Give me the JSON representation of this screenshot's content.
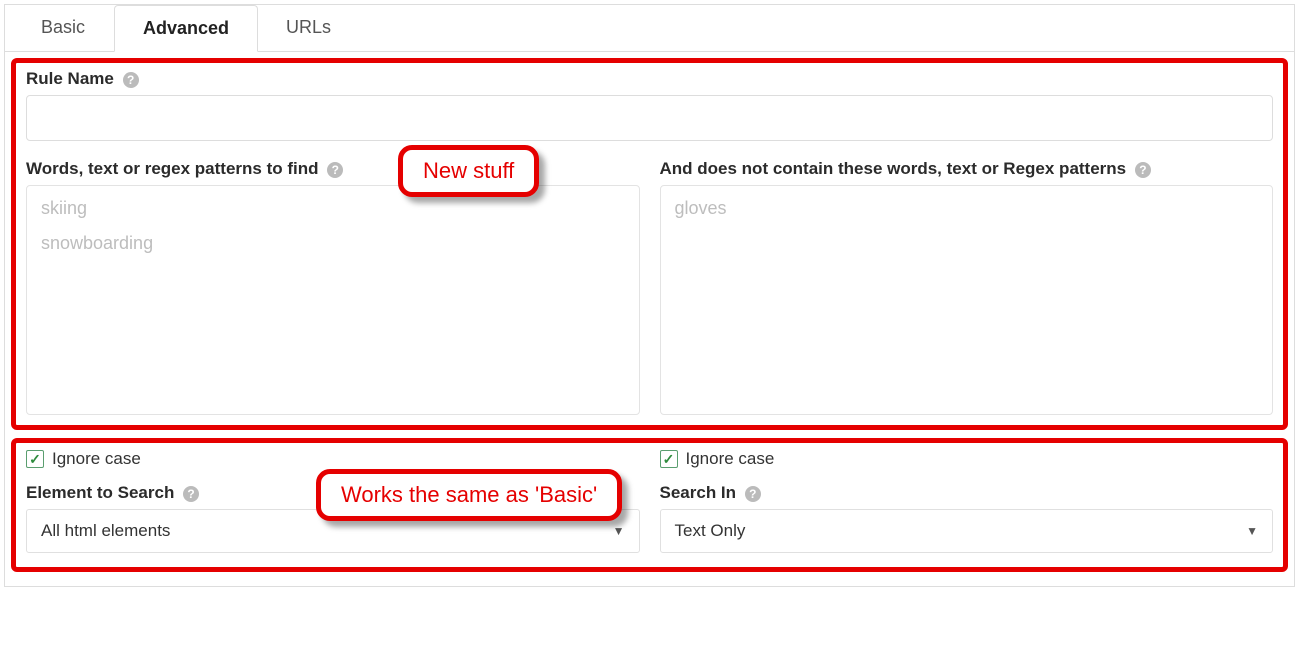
{
  "tabs": {
    "basic": "Basic",
    "advanced": "Advanced",
    "urls": "URLs"
  },
  "ruleName": {
    "label": "Rule Name",
    "value": ""
  },
  "findWords": {
    "label": "Words, text or regex patterns to find",
    "tags": [
      "skiing",
      "snowboarding"
    ]
  },
  "excludeWords": {
    "label": "And does not contain these words, text or Regex patterns",
    "tags": [
      "gloves"
    ]
  },
  "callouts": {
    "newStuff": "New stuff",
    "sameAsBasic": "Works the same as 'Basic'"
  },
  "left": {
    "ignoreCase": "Ignore case",
    "elementLabel": "Element to Search",
    "elementValue": "All html elements"
  },
  "right": {
    "ignoreCase": "Ignore case",
    "searchInLabel": "Search In",
    "searchInValue": "Text Only"
  }
}
